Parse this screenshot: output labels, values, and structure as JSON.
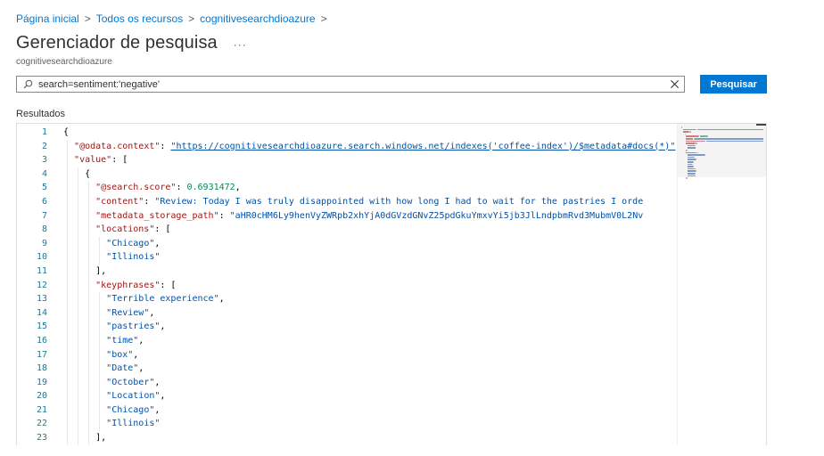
{
  "breadcrumb": {
    "items": [
      "Página inicial",
      "Todos os recursos",
      "cognitivesearchdioazure"
    ],
    "separator": ">"
  },
  "header": {
    "title": "Gerenciador de pesquisa",
    "more": "···",
    "subtitle": "cognitivesearchdioazure"
  },
  "search": {
    "value": "search=sentiment:'negative'",
    "button_label": "Pesquisar"
  },
  "results": {
    "label": "Resultados",
    "line_numbers": [
      "1",
      "2",
      "3",
      "4",
      "5",
      "6",
      "7",
      "8",
      "9",
      "10",
      "11",
      "12",
      "13",
      "14",
      "15",
      "16",
      "17",
      "18",
      "19",
      "20",
      "21",
      "22",
      "23"
    ],
    "lines": [
      [
        {
          "t": "{",
          "c": "p"
        }
      ],
      [
        {
          "t": "  ",
          "c": "p"
        },
        {
          "t": "\"@odata.context\"",
          "c": "k"
        },
        {
          "t": ": ",
          "c": "p"
        },
        {
          "t": "\"https://cognitivesearchdioazure.search.windows.net/indexes('coffee-index')/$metadata#docs(*)\"",
          "c": "s",
          "u": true
        },
        {
          "t": ",",
          "c": "p"
        }
      ],
      [
        {
          "t": "  ",
          "c": "p"
        },
        {
          "t": "\"value\"",
          "c": "k"
        },
        {
          "t": ": [",
          "c": "p"
        }
      ],
      [
        {
          "t": "    {",
          "c": "p"
        }
      ],
      [
        {
          "t": "      ",
          "c": "p"
        },
        {
          "t": "\"@search.score\"",
          "c": "k"
        },
        {
          "t": ": ",
          "c": "p"
        },
        {
          "t": "0.6931472",
          "c": "n"
        },
        {
          "t": ",",
          "c": "p"
        }
      ],
      [
        {
          "t": "      ",
          "c": "p"
        },
        {
          "t": "\"content\"",
          "c": "k"
        },
        {
          "t": ": ",
          "c": "p"
        },
        {
          "t": "\"Review: Today I was truly disappointed with how long I had to wait for the pastries I orde",
          "c": "s"
        }
      ],
      [
        {
          "t": "      ",
          "c": "p"
        },
        {
          "t": "\"metadata_storage_path\"",
          "c": "k"
        },
        {
          "t": ": ",
          "c": "p"
        },
        {
          "t": "\"aHR0cHM6Ly9henVyZWRpb2xhYjA0dGVzdGNvZ25pdGkuYmxvYi5jb3JlLndpbmRvd3MubmV0L2Nv",
          "c": "s"
        }
      ],
      [
        {
          "t": "      ",
          "c": "p"
        },
        {
          "t": "\"locations\"",
          "c": "k"
        },
        {
          "t": ": [",
          "c": "p"
        }
      ],
      [
        {
          "t": "        ",
          "c": "p"
        },
        {
          "t": "\"Chicago\"",
          "c": "s"
        },
        {
          "t": ",",
          "c": "p"
        }
      ],
      [
        {
          "t": "        ",
          "c": "p"
        },
        {
          "t": "\"Illinois\"",
          "c": "s"
        }
      ],
      [
        {
          "t": "      ],",
          "c": "p"
        }
      ],
      [
        {
          "t": "      ",
          "c": "p"
        },
        {
          "t": "\"keyphrases\"",
          "c": "k"
        },
        {
          "t": ": [",
          "c": "p"
        }
      ],
      [
        {
          "t": "        ",
          "c": "p"
        },
        {
          "t": "\"Terrible experience\"",
          "c": "s"
        },
        {
          "t": ",",
          "c": "p"
        }
      ],
      [
        {
          "t": "        ",
          "c": "p"
        },
        {
          "t": "\"Review\"",
          "c": "s"
        },
        {
          "t": ",",
          "c": "p"
        }
      ],
      [
        {
          "t": "        ",
          "c": "p"
        },
        {
          "t": "\"pastries\"",
          "c": "s"
        },
        {
          "t": ",",
          "c": "p"
        }
      ],
      [
        {
          "t": "        ",
          "c": "p"
        },
        {
          "t": "\"time\"",
          "c": "s"
        },
        {
          "t": ",",
          "c": "p"
        }
      ],
      [
        {
          "t": "        ",
          "c": "p"
        },
        {
          "t": "\"box\"",
          "c": "s"
        },
        {
          "t": ",",
          "c": "p"
        }
      ],
      [
        {
          "t": "        ",
          "c": "p"
        },
        {
          "t": "\"Date\"",
          "c": "s"
        },
        {
          "t": ",",
          "c": "p"
        }
      ],
      [
        {
          "t": "        ",
          "c": "p"
        },
        {
          "t": "\"October\"",
          "c": "s"
        },
        {
          "t": ",",
          "c": "p"
        }
      ],
      [
        {
          "t": "        ",
          "c": "p"
        },
        {
          "t": "\"Location\"",
          "c": "s"
        },
        {
          "t": ",",
          "c": "p"
        }
      ],
      [
        {
          "t": "        ",
          "c": "p"
        },
        {
          "t": "\"Chicago\"",
          "c": "s"
        },
        {
          "t": ",",
          "c": "p"
        }
      ],
      [
        {
          "t": "        ",
          "c": "p"
        },
        {
          "t": "\"Illinois\"",
          "c": "s"
        }
      ],
      [
        {
          "t": "      ],",
          "c": "p"
        }
      ]
    ]
  },
  "icons": {
    "search": "search-icon",
    "clear": "close-icon",
    "more": "more-icon"
  },
  "colors": {
    "accent": "#0078d4",
    "json_key": "#a31515",
    "json_string": "#0451a5",
    "json_number": "#098658",
    "line_number": "#237893"
  }
}
